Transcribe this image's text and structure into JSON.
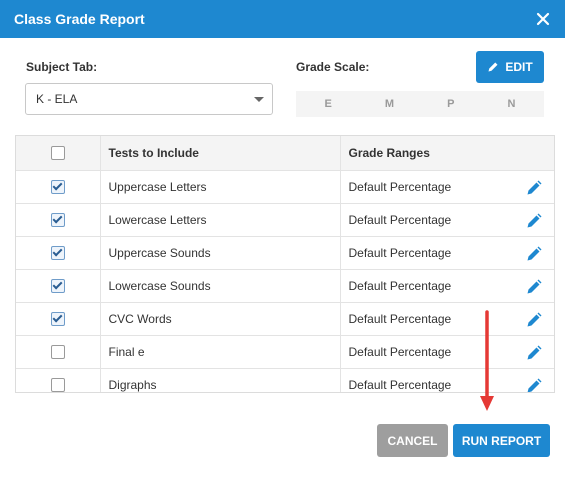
{
  "dialog": {
    "title": "Class Grade Report"
  },
  "subject": {
    "label": "Subject Tab:",
    "value": "K - ELA"
  },
  "grade_scale": {
    "label": "Grade Scale:",
    "levels": [
      "E",
      "M",
      "P",
      "N"
    ],
    "edit_label": "EDIT"
  },
  "table": {
    "headers": {
      "tests": "Tests to Include",
      "ranges": "Grade Ranges"
    },
    "header_checked": false,
    "rows": [
      {
        "name": "Uppercase Letters",
        "range": "Default Percentage",
        "checked": true
      },
      {
        "name": "Lowercase Letters",
        "range": "Default Percentage",
        "checked": true
      },
      {
        "name": "Uppercase Sounds",
        "range": "Default Percentage",
        "checked": true
      },
      {
        "name": "Lowercase Sounds",
        "range": "Default Percentage",
        "checked": true
      },
      {
        "name": "CVC Words",
        "range": "Default Percentage",
        "checked": true
      },
      {
        "name": "Final e",
        "range": "Default Percentage",
        "checked": false
      },
      {
        "name": "Digraphs",
        "range": "Default Percentage",
        "checked": false
      }
    ]
  },
  "footer": {
    "cancel_label": "CANCEL",
    "run_label": "RUN REPORT"
  },
  "colors": {
    "primary": "#1e88d0",
    "cancel": "#9e9e9e",
    "annotation_arrow": "#e53935"
  },
  "icons": {
    "close": "close-icon",
    "edit": "pencil-icon",
    "row_edit": "pencil-icon",
    "dropdown": "chevron-down-icon"
  }
}
